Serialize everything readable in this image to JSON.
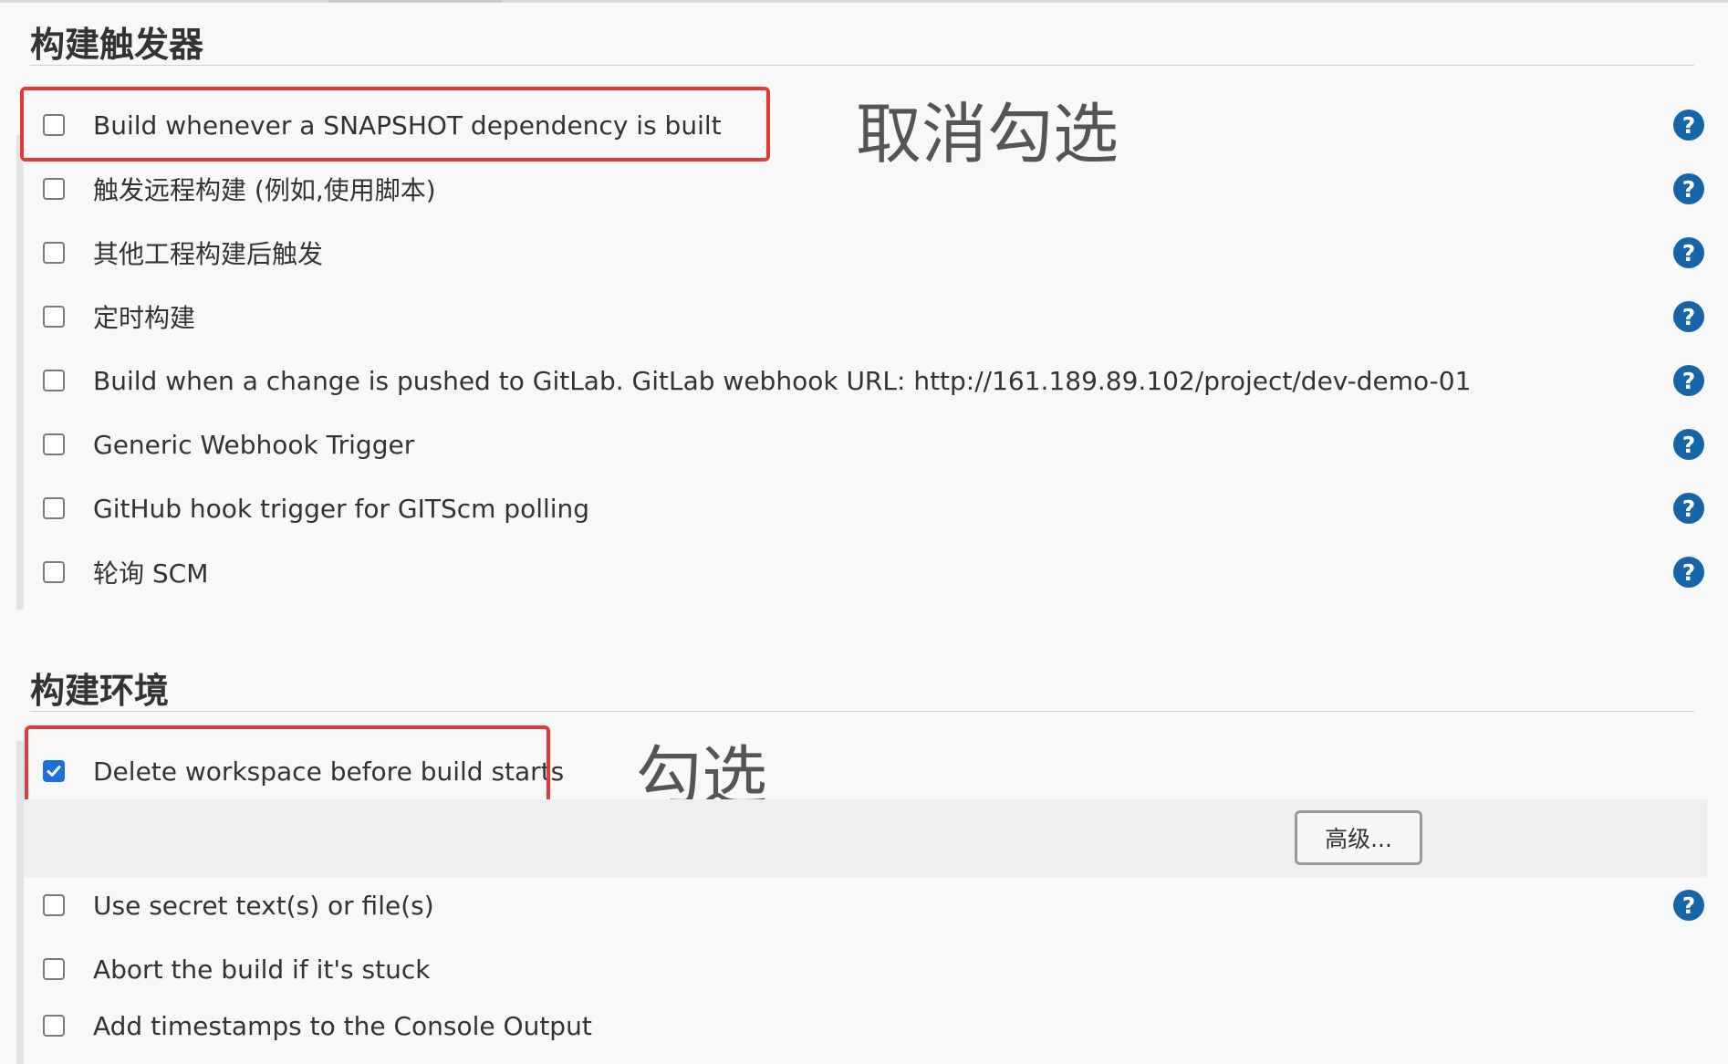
{
  "triggers_section": {
    "title": "构建触发器",
    "items": [
      {
        "label": "Build whenever a SNAPSHOT dependency is built",
        "checked": false
      },
      {
        "label": "触发远程构建 (例如,使用脚本)",
        "checked": false
      },
      {
        "label": "其他工程构建后触发",
        "checked": false
      },
      {
        "label": "定时构建",
        "checked": false
      },
      {
        "label": "Build when a change is pushed to GitLab. GitLab webhook URL: http://161.189.89.102/project/dev-demo-01",
        "checked": false
      },
      {
        "label": "Generic Webhook Trigger",
        "checked": false
      },
      {
        "label": "GitHub hook trigger for GITScm polling",
        "checked": false
      },
      {
        "label": "轮询 SCM",
        "checked": false
      }
    ],
    "annotation": "取消勾选"
  },
  "environment_section": {
    "title": "构建环境",
    "items": [
      {
        "label": "Delete workspace before build starts",
        "checked": true
      },
      {
        "label": "Use secret text(s) or file(s)",
        "checked": false
      },
      {
        "label": "Abort the build if it's stuck",
        "checked": false
      },
      {
        "label": "Add timestamps to the Console Output",
        "checked": false
      }
    ],
    "advanced_button": "高级...",
    "annotation": "勾选"
  },
  "help_icon": "question-mark-icon",
  "colors": {
    "accent": "#1a6fd8",
    "help_icon": "#1565a8",
    "highlight": "#e53935"
  }
}
